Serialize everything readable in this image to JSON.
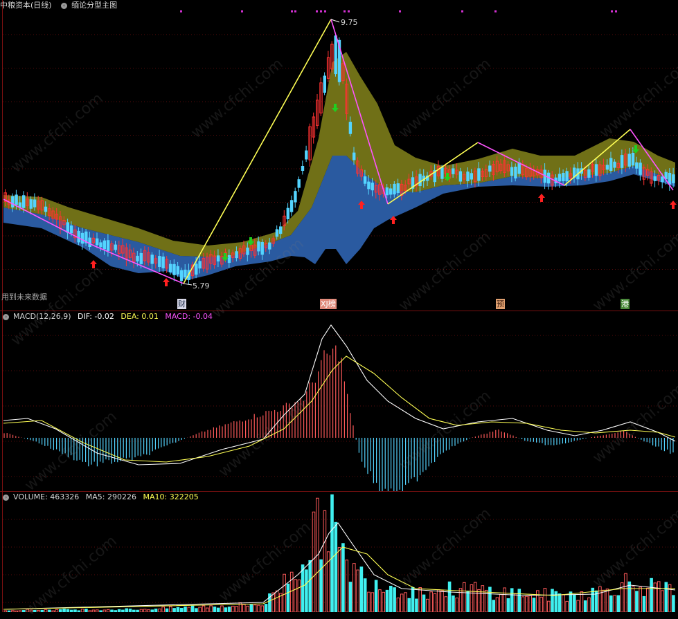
{
  "main_panel": {
    "stock_name": "中粮资本",
    "period": "(日线)",
    "indicator_name": "缅论分型主图",
    "high_label": "9.75",
    "low_label": "5.79",
    "future_data_note": "用到未来数据",
    "event_markers": [
      {
        "text": "财",
        "bg": "#d8d8e8",
        "fg": "#20304a"
      },
      {
        "text": "XJ榜",
        "bg": "#e08a7a",
        "fg": "#ffffff"
      },
      {
        "text": "预",
        "bg": "#e0a070",
        "fg": "#402010"
      },
      {
        "text": "港",
        "bg": "#4a8a3a",
        "fg": "#ffffff"
      }
    ],
    "colors": {
      "up": "#ff3232",
      "down": "#54d4ff",
      "band_olive": "#707017",
      "band_blue": "#2a5aa0",
      "zig_up": "#ffff54",
      "zig_down": "#ff54ff"
    }
  },
  "macd_panel": {
    "title": "MACD(12,26,9)",
    "dif_label": "DIF: -0.02",
    "dea_label": "DEA: 0.01",
    "macd_label": "MACD: -0.04",
    "colors": {
      "dif": "#ffffff",
      "dea": "#ffff54",
      "macd": "#ff54ff"
    }
  },
  "volume_panel": {
    "title": "VOLUME: 463326",
    "ma5_label": "MA5: 290226",
    "ma10_label": "MA10: 322205",
    "colors": {
      "vol": "#c8c8c8",
      "ma5": "#c8c8c8",
      "ma10": "#ffff54"
    }
  },
  "watermark": "www.cfchi.com"
}
